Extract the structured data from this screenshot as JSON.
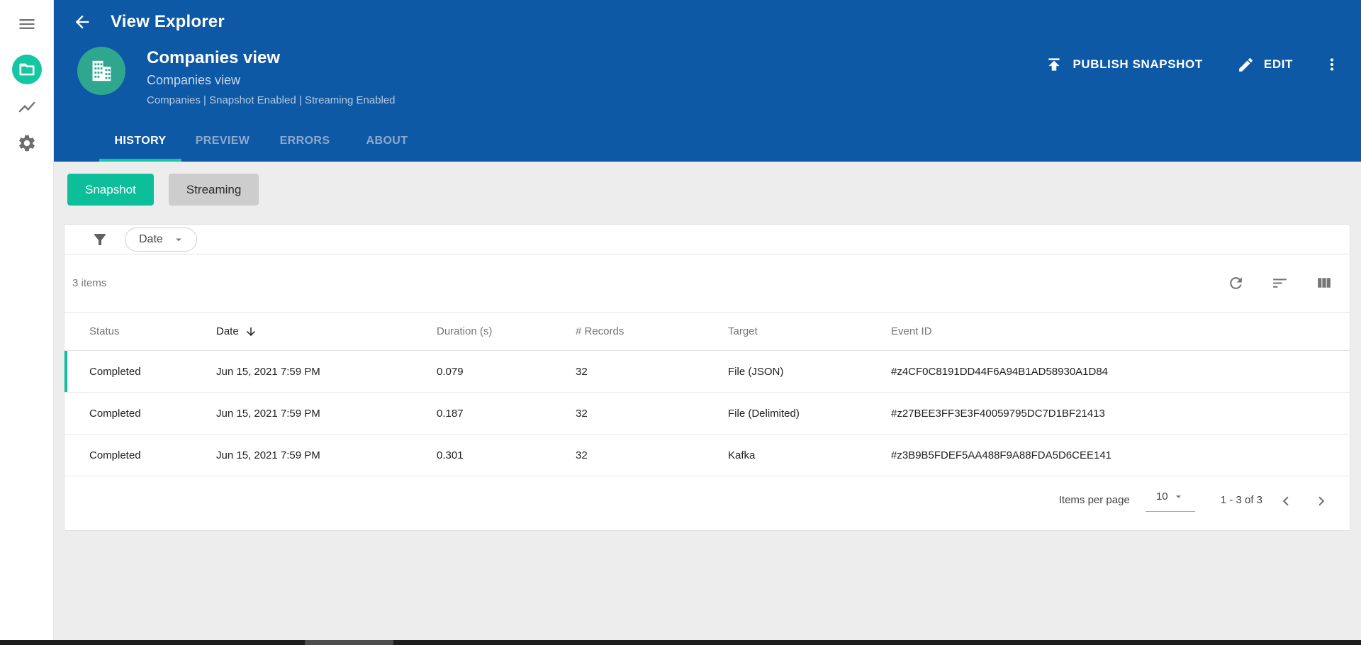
{
  "colors": {
    "header_blue": "#0e59a6",
    "accent_teal": "#0dbe9b",
    "sidebar_badge_teal": "#12c7a2",
    "avatar_teal": "#2fa78f",
    "active_tab_underline": "#16c79f",
    "selected_row_indicator": "#10bf9f",
    "page_background": "#ededed"
  },
  "sidebar": {
    "icons": [
      "menu-icon",
      "views-folder-badge-icon",
      "metrics-trend-icon",
      "settings-gear-icon"
    ]
  },
  "topbar": {
    "title": "View Explorer"
  },
  "view_header": {
    "title": "Companies view",
    "subtitle": "Companies view",
    "meta": "Companies | Snapshot Enabled | Streaming Enabled",
    "publish_button": "PUBLISH SNAPSHOT",
    "edit_button": "EDIT"
  },
  "tabs": {
    "items": [
      {
        "label": "HISTORY",
        "active": true
      },
      {
        "label": "PREVIEW",
        "active": false
      },
      {
        "label": "ERRORS",
        "active": false
      },
      {
        "label": "ABOUT",
        "active": false
      }
    ]
  },
  "toggles": {
    "items": [
      {
        "label": "Snapshot",
        "active": true
      },
      {
        "label": "Streaming",
        "active": false
      }
    ]
  },
  "filter": {
    "date_chip": "Date"
  },
  "list_toolbar": {
    "items_count": "3 items",
    "icons": [
      "refresh-icon",
      "sort-icon",
      "columns-icon"
    ]
  },
  "table": {
    "columns": [
      "Status",
      "Date",
      "Duration (s)",
      "# Records",
      "Target",
      "Event ID"
    ],
    "sorted_by": "Date",
    "sort_direction": "descending",
    "rows": [
      {
        "status": "Completed",
        "date": "Jun 15, 2021 7:59 PM",
        "duration": "0.079",
        "records": "32",
        "target": "File (JSON)",
        "event_id": "#z4CF0C8191DD44F6A94B1AD58930A1D84"
      },
      {
        "status": "Completed",
        "date": "Jun 15, 2021 7:59 PM",
        "duration": "0.187",
        "records": "32",
        "target": "File (Delimited)",
        "event_id": "#z27BEE3FF3E3F40059795DC7D1BF21413"
      },
      {
        "status": "Completed",
        "date": "Jun 15, 2021 7:59 PM",
        "duration": "0.301",
        "records": "32",
        "target": "Kafka",
        "event_id": "#z3B9B5FDEF5AA488F9A88FDA5D6CEE141"
      }
    ]
  },
  "pagination": {
    "items_per_page_label": "Items per page",
    "items_per_page_value": "10",
    "range": "1 - 3 of 3"
  }
}
